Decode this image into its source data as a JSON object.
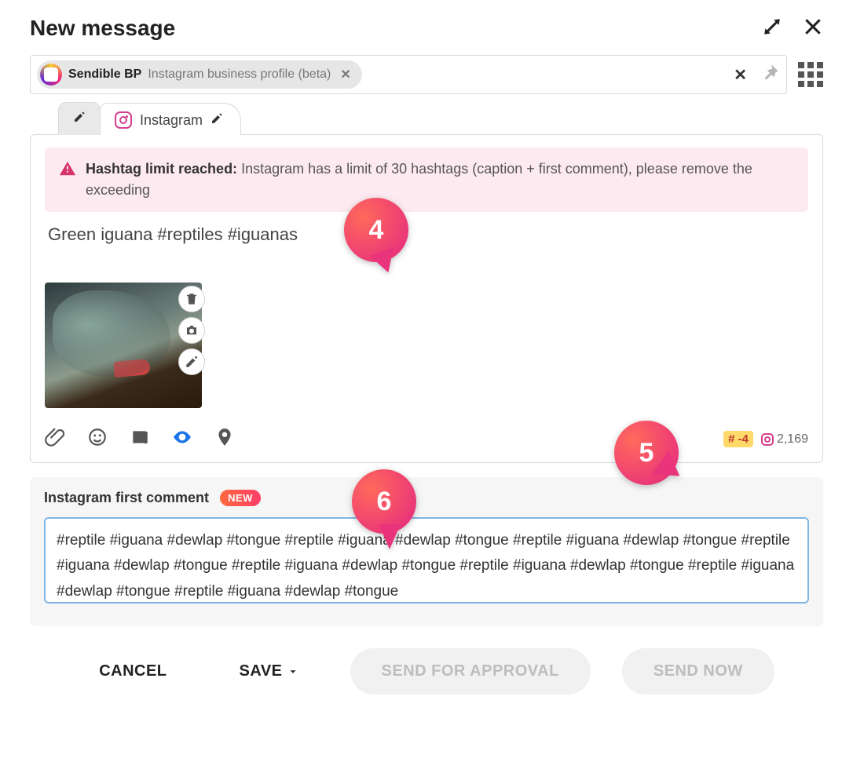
{
  "header": {
    "title": "New message"
  },
  "account": {
    "name": "Sendible BP",
    "subtype": "Instagram business profile (beta)"
  },
  "tabs": {
    "instagram_label": "Instagram"
  },
  "warning": {
    "strong": "Hashtag limit reached:",
    "body": "Instagram has a limit of 30 hashtags (caption + first comment), please remove the exceeding"
  },
  "caption": "Green iguana #reptiles #iguanas",
  "counters": {
    "hashtag_delta": "-4",
    "char_count": "2,169"
  },
  "first_comment": {
    "title": "Instagram first comment",
    "badge": "NEW",
    "value": "#reptile #iguana #dewlap #tongue #reptile #iguana #dewlap #tongue #reptile #iguana #dewlap #tongue #reptile #iguana #dewlap #tongue #reptile #iguana #dewlap #tongue #reptile #iguana #dewlap #tongue #reptile #iguana #dewlap #tongue #reptile #iguana #dewlap #tongue"
  },
  "footer": {
    "cancel": "CANCEL",
    "save": "SAVE",
    "approval": "SEND FOR APPROVAL",
    "send_now": "SEND NOW"
  },
  "annotations": {
    "a4": "4",
    "a5": "5",
    "a6": "6"
  }
}
